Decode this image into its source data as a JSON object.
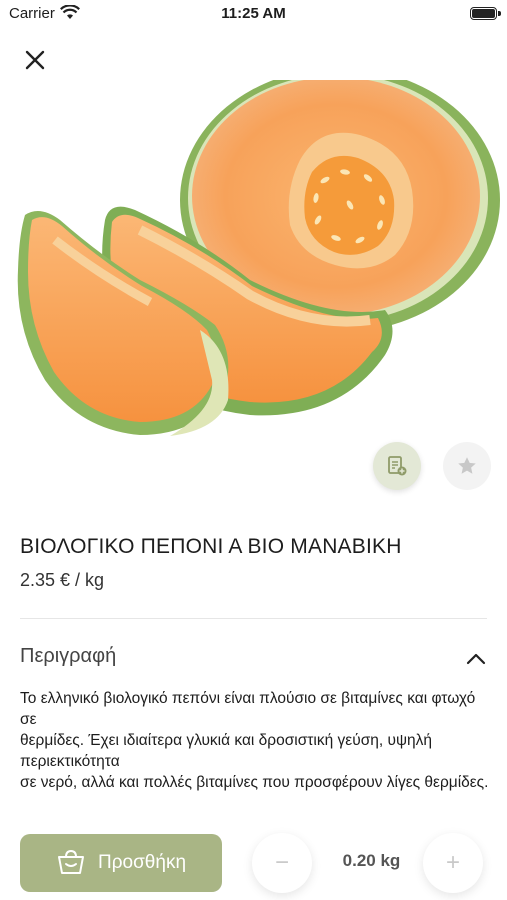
{
  "status_bar": {
    "carrier": "Carrier",
    "time": "11:25 AM"
  },
  "product": {
    "image_icon": "cantaloupe-melon-image",
    "title": "ΒΙΟΛΟΓΙΚΟ ΠΕΠΟΝΙ Α ΒΙΟ ΜΑΝΑΒΙΚΗ",
    "price": "2.35 € / kg"
  },
  "actions": {
    "note_icon": "add-note-icon",
    "favorite_icon": "star-icon"
  },
  "description": {
    "heading": "Περιγραφή",
    "text": "Το ελληνικό βιολογικό πεπόνι είναι πλούσιο σε βιταμίνες και φτωχό σε\nθερμίδες. Έχει ιδιαίτερα γλυκιά και δροσιστική γεύση, υψηλή περιεκτικότητα\nσε νερό, αλλά και πολλές βιταμίνες που προσφέρουν λίγες θερμίδες."
  },
  "cart": {
    "add_label": "Προσθήκη",
    "minus_label": "−",
    "plus_label": "+",
    "quantity": "0.20 kg"
  },
  "colors": {
    "accent": "#a9b585",
    "accent_light": "#e3e8d6",
    "melon_flesh": "#f7a25a",
    "rind": "#6aa84f"
  }
}
